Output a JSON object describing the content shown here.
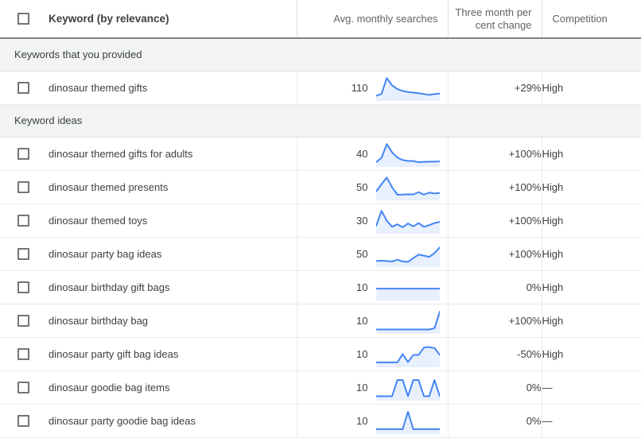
{
  "theme": {
    "line_color": "#4285f4",
    "fill_color": "#e8f0fe",
    "header_text_color": "#5f6368",
    "group_bg": "#f1f3f4",
    "text_color": "#3c4043"
  },
  "table": {
    "columns": [
      {
        "key": "keyword",
        "label": "Keyword (by relevance)",
        "align": "left"
      },
      {
        "key": "searches",
        "label": "Avg. monthly searches",
        "align": "right"
      },
      {
        "key": "change",
        "label": "Three month per cent change",
        "align": "right"
      },
      {
        "key": "competition",
        "label": "Competition",
        "align": "left"
      }
    ],
    "header_change_line1": "Three month per",
    "header_change_line2": "cent change",
    "select_all_checkbox": "unchecked",
    "groups": [
      {
        "title": "Keywords that you provided",
        "rows": [
          {
            "keyword": "dinosaur themed gifts",
            "searches": "110",
            "change": "+29%",
            "competition": "High",
            "checkbox": "unchecked",
            "spark": [
              10,
              18,
              95,
              60,
              42,
              33,
              28,
              25,
              22,
              18,
              14,
              18,
              20
            ]
          }
        ]
      },
      {
        "title": "Keyword ideas",
        "rows": [
          {
            "keyword": "dinosaur themed gifts for adults",
            "searches": "40",
            "change": "+100%",
            "competition": "High",
            "checkbox": "unchecked",
            "spark": [
              8,
              28,
              95,
              55,
              30,
              18,
              14,
              13,
              8,
              9,
              10,
              10,
              12
            ]
          },
          {
            "keyword": "dinosaur themed presents",
            "searches": "50",
            "change": "+100%",
            "competition": "High",
            "checkbox": "unchecked",
            "spark": [
              28,
              62,
              95,
              48,
              12,
              12,
              14,
              13,
              24,
              12,
              22,
              18,
              20
            ]
          },
          {
            "keyword": "dinosaur themed toys",
            "searches": "30",
            "change": "+100%",
            "competition": "High",
            "checkbox": "unchecked",
            "spark": [
              22,
              95,
              48,
              18,
              30,
              16,
              34,
              20,
              36,
              18,
              26,
              36,
              42
            ]
          },
          {
            "keyword": "dinosaur party bag ideas",
            "searches": "50",
            "change": "+100%",
            "competition": "High",
            "checkbox": "unchecked",
            "spark": [
              14,
              16,
              14,
              12,
              20,
              12,
              10,
              28,
              45,
              40,
              34,
              52,
              80
            ]
          },
          {
            "keyword": "dinosaur birthday gift bags",
            "searches": "10",
            "change": "0%",
            "competition": "High",
            "checkbox": "unchecked",
            "spark": [
              42,
              42,
              42,
              42,
              42,
              42,
              42,
              42,
              42,
              42,
              42,
              42,
              42
            ]
          },
          {
            "keyword": "dinosaur birthday bag",
            "searches": "10",
            "change": "+100%",
            "competition": "High",
            "checkbox": "unchecked",
            "spark": [
              6,
              6,
              6,
              6,
              6,
              6,
              6,
              6,
              6,
              6,
              6,
              12,
              92
            ]
          },
          {
            "keyword": "dinosaur party gift bag ideas",
            "searches": "10",
            "change": "-50%",
            "competition": "High",
            "checkbox": "unchecked",
            "spark": [
              8,
              8,
              8,
              8,
              8,
              48,
              10,
              44,
              44,
              80,
              82,
              78,
              44
            ]
          },
          {
            "keyword": "dinosaur goodie bag items",
            "searches": "10",
            "change": "0%",
            "competition": "—",
            "checkbox": "unchecked",
            "spark": [
              6,
              6,
              6,
              6,
              84,
              84,
              6,
              84,
              84,
              6,
              6,
              84,
              6
            ]
          },
          {
            "keyword": "dinosaur party goodie bag ideas",
            "searches": "10",
            "change": "0%",
            "competition": "—",
            "checkbox": "unchecked",
            "spark": [
              8,
              8,
              8,
              8,
              8,
              8,
              92,
              8,
              8,
              8,
              8,
              8,
              8
            ]
          }
        ]
      }
    ]
  }
}
